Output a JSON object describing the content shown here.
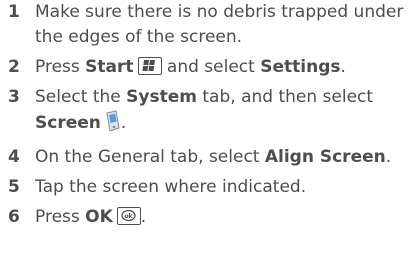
{
  "steps": [
    {
      "number": "1",
      "text_a": "Make sure there is no debris trapped under the edges of the screen."
    },
    {
      "number": "2",
      "text_a": "Press ",
      "bold_a": "Start",
      "text_b": " and select ",
      "bold_b": "Settings",
      "text_c": ".",
      "icon": "windows-start-key-icon"
    },
    {
      "number": "3",
      "text_a": "Select the ",
      "bold_a": "System",
      "text_b": " tab, and then select ",
      "bold_b": "Screen",
      "text_c": ".",
      "icon": "screen-phone-icon"
    },
    {
      "number": "4",
      "text_a": "On the General tab, select ",
      "bold_a": "Align Screen",
      "text_b": "."
    },
    {
      "number": "5",
      "text_a": "Tap the screen where indicated."
    },
    {
      "number": "6",
      "text_a": "Press ",
      "bold_a": "OK",
      "text_b": ".",
      "icon": "ok-key-icon"
    }
  ],
  "colors": {
    "text": "#4d4d4d",
    "icon_blue": "#5b9bd5"
  }
}
